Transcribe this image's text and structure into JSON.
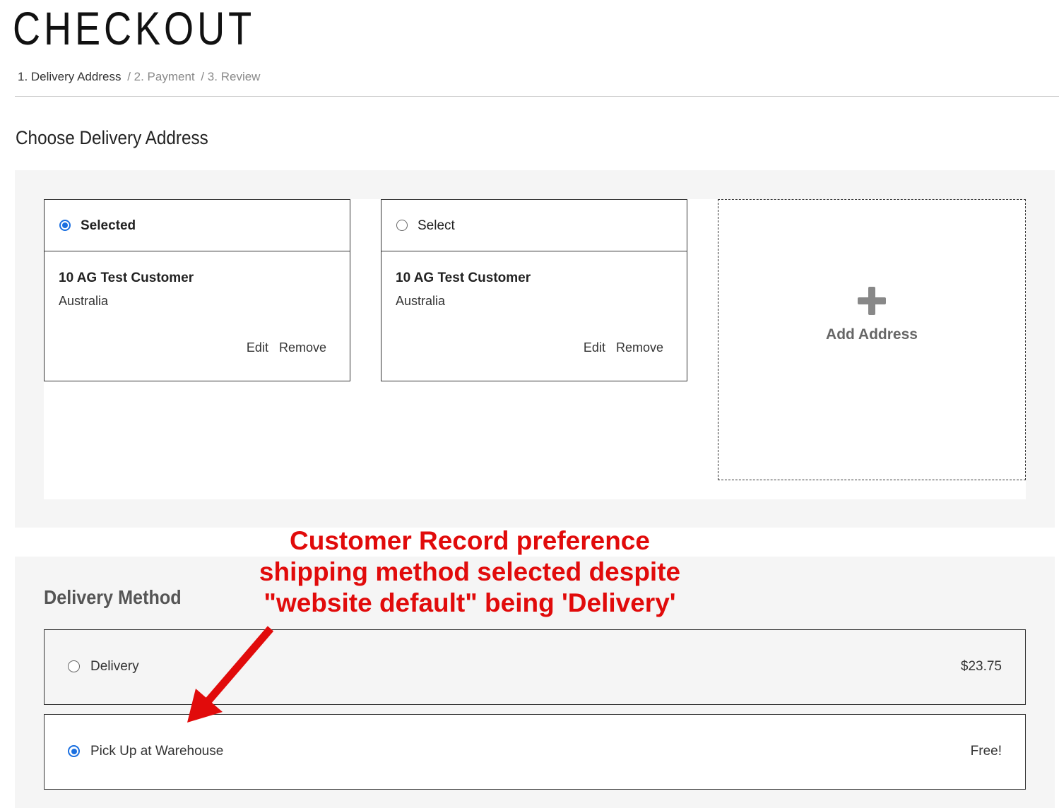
{
  "page": {
    "title": "CHECKOUT"
  },
  "steps": [
    {
      "label": "1. Delivery Address"
    },
    {
      "label": "/ 2. Payment"
    },
    {
      "label": "/ 3. Review"
    }
  ],
  "delivery_address": {
    "title": "Choose Delivery Address",
    "cards": [
      {
        "select_label": "Selected",
        "checked": true,
        "name": "10 AG Test Customer",
        "country": "Australia",
        "edit_label": "Edit",
        "remove_label": "Remove"
      },
      {
        "select_label": "Select",
        "checked": false,
        "name": "10 AG Test Customer",
        "country": "Australia",
        "edit_label": "Edit",
        "remove_label": "Remove"
      }
    ],
    "add_label": "Add Address"
  },
  "delivery_method": {
    "title": "Delivery Method",
    "options": [
      {
        "label": "Delivery",
        "price": "$23.75",
        "checked": false
      },
      {
        "label": "Pick Up at Warehouse",
        "price": "Free!",
        "checked": true
      }
    ]
  },
  "annotation": {
    "line1": "Customer Record preference",
    "line2": "shipping method selected despite",
    "line3": "\"website default\" being 'Delivery'",
    "color": "#e10b0b"
  },
  "colors": {
    "radio_accent": "#1a6fe0",
    "panel_bg": "#f5f5f5"
  }
}
